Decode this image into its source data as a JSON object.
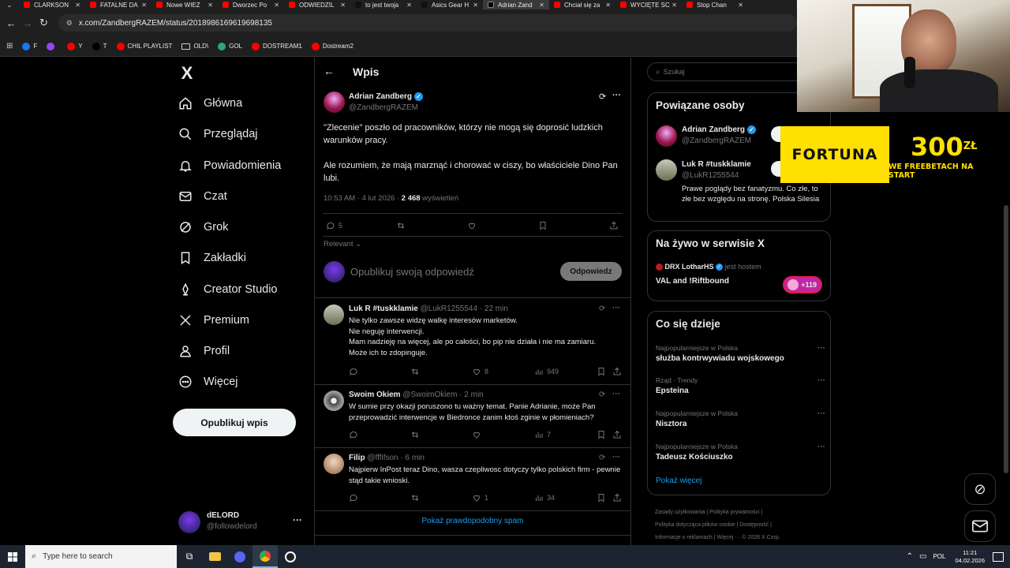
{
  "browser": {
    "tabs": [
      {
        "label": "CLARKSON",
        "color": "#ff0000"
      },
      {
        "label": "FATALNE DA",
        "color": "#ff0000"
      },
      {
        "label": "Nowe WIEZ",
        "color": "#ff0000"
      },
      {
        "label": "Dworzec Po",
        "color": "#ff0000"
      },
      {
        "label": "ODWIEDZIL",
        "color": "#ff0000"
      },
      {
        "label": "to jest twoja",
        "color": "#111111"
      },
      {
        "label": "Asics Gear H",
        "color": "#111111"
      },
      {
        "label": "Adrian Zand",
        "color": "#000000",
        "active": true
      },
      {
        "label": "Chciał się za",
        "color": "#ff0000"
      },
      {
        "label": "WYCIĘTE SC",
        "color": "#ff0000"
      },
      {
        "label": "Stop Chan",
        "color": "#ff0000"
      }
    ],
    "url": "x.com/ZandbergRAZEM/status/2018986169619698135",
    "bookmarks": [
      {
        "label": "F",
        "color": "#1877f2"
      },
      {
        "label": "",
        "color": "#9146ff"
      },
      {
        "label": "Y",
        "color": "#ff0000"
      },
      {
        "label": "T",
        "color": "#000000"
      },
      {
        "label": "CHIL PLAYLIST",
        "color": "#ff0000"
      },
      {
        "label": "OLD\\",
        "color": "folder"
      },
      {
        "label": "GOL",
        "color": "#2aa876"
      },
      {
        "label": "DOSTREAM1",
        "color": "#ff0000"
      },
      {
        "label": "Dostream2",
        "color": "#ff0000"
      }
    ]
  },
  "nav": {
    "logo": "X",
    "items": [
      {
        "label": "Główna",
        "icon": "home-icon"
      },
      {
        "label": "Przeglądaj",
        "icon": "search-icon"
      },
      {
        "label": "Powiadomienia",
        "icon": "bell-icon"
      },
      {
        "label": "Czat",
        "icon": "mail-icon"
      },
      {
        "label": "Grok",
        "icon": "grok-icon"
      },
      {
        "label": "Zakładki",
        "icon": "bookmark-icon"
      },
      {
        "label": "Creator Studio",
        "icon": "creator-icon"
      },
      {
        "label": "Premium",
        "icon": "x-icon"
      },
      {
        "label": "Profil",
        "icon": "person-icon"
      },
      {
        "label": "Więcej",
        "icon": "more-circle-icon"
      }
    ],
    "post_button": "Opublikuj wpis",
    "account": {
      "name": "dELORD",
      "handle": "@followdelord"
    }
  },
  "post": {
    "header": "Wpis",
    "author": "Adrian Zandberg",
    "handle": "@ZandbergRAZEM",
    "text1": "\"Zlecenie\" poszło od pracowników, którzy nie mogą się doprosić ludzkich warunków pracy.",
    "text2": "Ale rozumiem, że mają marznąć i chorować w ciszy, bo właściciele Dino Pan lubi.",
    "time": "10:53 AM · 4 lut 2026 · ",
    "views": "2 468",
    "views_label": " wyświetleń",
    "replies": "5",
    "likes": "",
    "sort": "Relevant",
    "reply_placeholder": "Opublikuj swoją odpowiedź",
    "reply_button": "Odpowiedz"
  },
  "replies": [
    {
      "name": "Luk R #tuskklamie",
      "handle": "@LukR1255544 · 22 min",
      "text": "Nie tylko zawsze widzę walkę interesów marketów.\nNie neguję interwencji.\nMam nadzieję na więcej, ale po całości, bo pip nie działa i nie ma zamiaru.\nMoże ich to zdopinguje.",
      "replies": "",
      "reposts": "",
      "likes": "8",
      "views": "949"
    },
    {
      "name": "Swoim Okiem",
      "handle": "@SwoimOkiem · 2 min",
      "text": "W sumie przy okazji poruszono tu ważny temat. Panie Adrianie, może Pan przeprowadzić interwencje w Biedronce zanim ktoś zginie w płomieniach?",
      "replies": "",
      "reposts": "",
      "likes": "",
      "views": "7"
    },
    {
      "name": "Filip",
      "handle": "@fffifson · 6 min",
      "text": "Najpierw InPost teraz Dino, wasza czepliwosc dotyczy tylko polskich firm - pewnie stąd takie wnioski.",
      "replies": "",
      "reposts": "",
      "likes": "1",
      "views": "34"
    }
  ],
  "spam_link": "Pokaż prawdopodobny spam",
  "right": {
    "search_placeholder": "Szukaj",
    "related_title": "Powiązane osoby",
    "related": [
      {
        "name": "Adrian Zandberg",
        "handle": "@ZandbergRAZEM",
        "bio": ""
      },
      {
        "name": "Luk R #tuskklamie",
        "handle": "@LukR1255544",
        "bio": "Prawe poglądy bez fanatyzmu. Co złe, to złe bez względu na stronę. Polska Silesia"
      }
    ],
    "live_title": "Na żywo w serwisie X",
    "live_host": "DRX LotharHS",
    "live_host_suffix": "jest hostem",
    "live_title_text": "VAL and !Riftbound",
    "live_count": "+119",
    "trends_title": "Co się dzieje",
    "trends": [
      {
        "meta": "Najpopularniejsze w Polska",
        "name": "służba kontrwywiadu wojskowego"
      },
      {
        "meta": "Rząd · Trendy",
        "name": "Epsteina"
      },
      {
        "meta": "Najpopularniejsze w Polska",
        "name": "Nisztora"
      },
      {
        "meta": "Najpopularniejsze w Polska",
        "name": "Tadeusz Kościuszko"
      }
    ],
    "show_more": "Pokaż więcej",
    "footer1": "Zasady użytkowania  |  Polityka prywatności  |",
    "footer2": "Polityka dotycząca plików cookie  |  Dostępność  |",
    "footer3": "Informacje o reklamach  |  Więcej ···  © 2026 X Corp."
  },
  "ad": {
    "brand": "FORTUNA",
    "amount": "300",
    "currency": "ZŁ",
    "tagline": "WE FREEBETACH NA START"
  },
  "taskbar": {
    "search": "Type here to search",
    "lang": "POL",
    "time": "11:21",
    "date": "04.02.2026"
  }
}
